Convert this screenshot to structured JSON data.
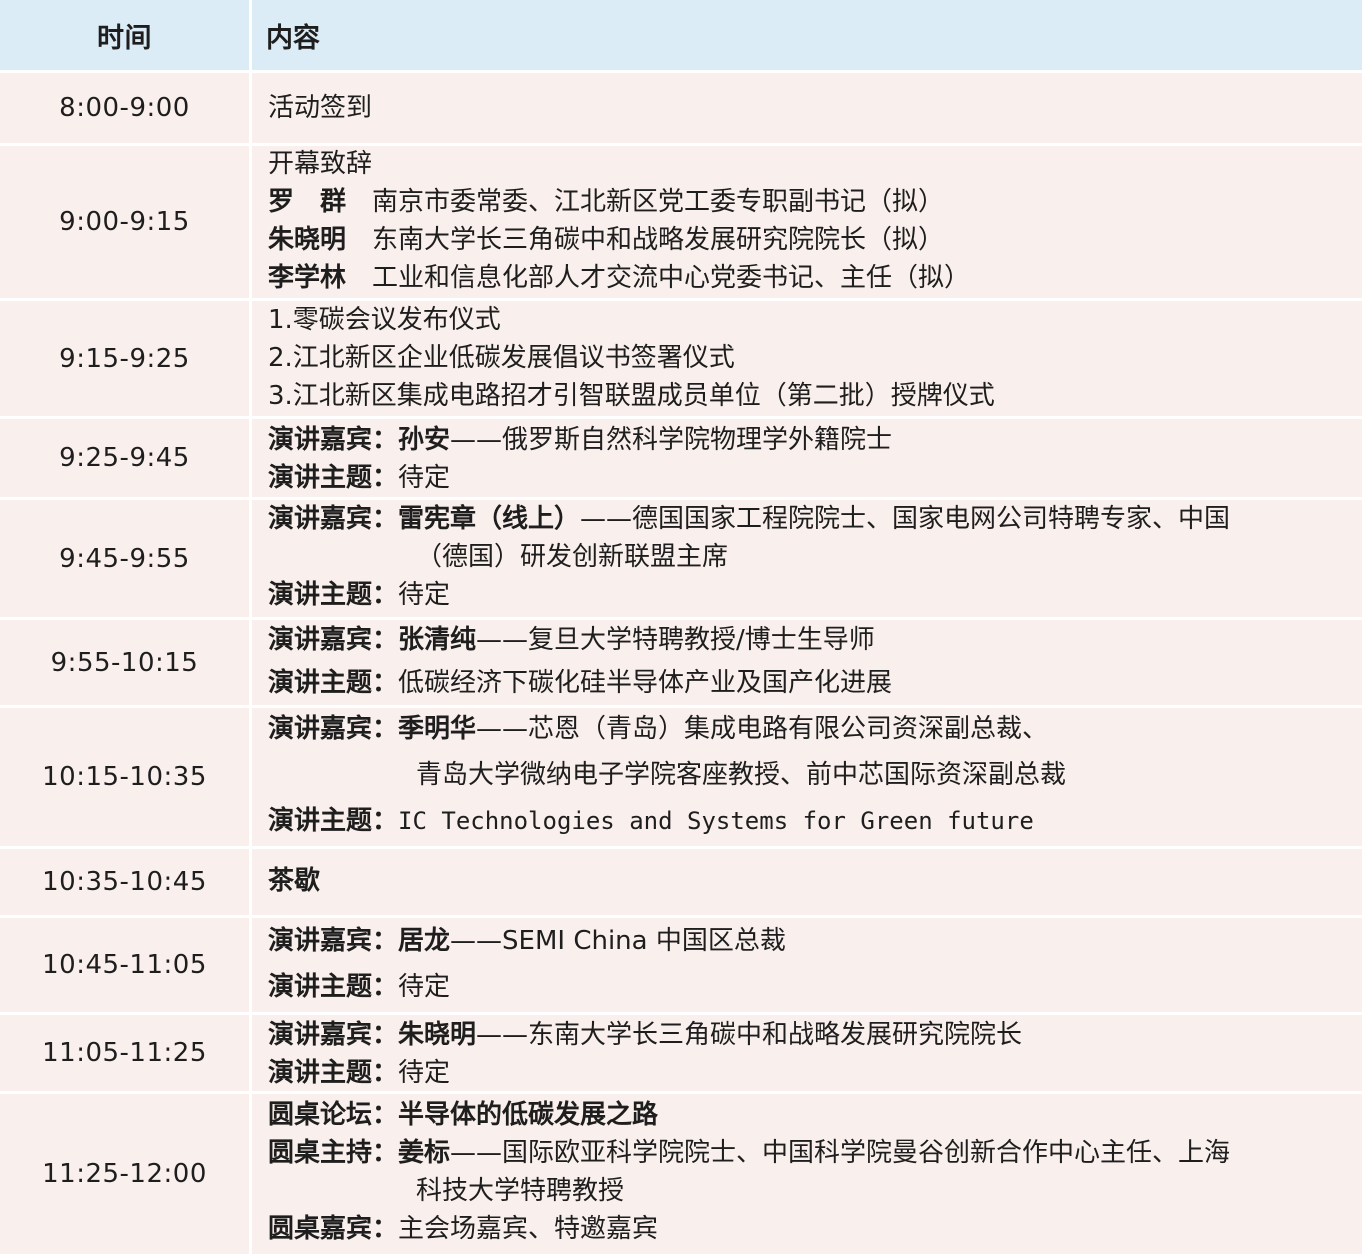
{
  "header": {
    "time": "时间",
    "content": "内容"
  },
  "rows": [
    {
      "time": "8:00-9:00",
      "lines": [
        {
          "t": "活动签到"
        }
      ]
    },
    {
      "time": "9:00-9:15",
      "lines": [
        {
          "t": "开幕致辞"
        },
        {
          "b": "罗　群",
          "t": "南京市委常委、江北新区党工委专职副书记（拟）"
        },
        {
          "b": "朱晓明",
          "t": "东南大学长三角碳中和战略发展研究院院长（拟）"
        },
        {
          "b": "李学林",
          "t": "工业和信息化部人才交流中心党委书记、主任（拟）"
        }
      ]
    },
    {
      "time": "9:15-9:25",
      "lines": [
        {
          "t": "1.零碳会议发布仪式"
        },
        {
          "t": "2.江北新区企业低碳发展倡议书签署仪式"
        },
        {
          "t": "3.江北新区集成电路招才引智联盟成员单位（第二批）授牌仪式"
        }
      ]
    },
    {
      "time": "9:25-9:45",
      "lines": [
        {
          "b": "演讲嘉宾：孙安",
          "t": "——俄罗斯自然科学院物理学外籍院士"
        },
        {
          "b": "演讲主题：",
          "t": "待定"
        }
      ]
    },
    {
      "time": "9:45-9:55",
      "lines": [
        {
          "b": "演讲嘉宾：雷宪章（线上）",
          "t": "——德国国家工程院院士、国家电网公司特聘专家、中国"
        },
        {
          "t": "（德国）研发创新联盟主席"
        },
        {
          "b": "演讲主题：",
          "t": "待定"
        }
      ]
    },
    {
      "time": "9:55-10:15",
      "lines": [
        {
          "b": "演讲嘉宾：张清纯",
          "t": "——复旦大学特聘教授/博士生导师"
        },
        {
          "b": "演讲主题：",
          "t": "低碳经济下碳化硅半导体产业及国产化进展"
        }
      ]
    },
    {
      "time": "10:15-10:35",
      "lines": [
        {
          "b": "演讲嘉宾：季明华",
          "t": "——芯恩（青岛）集成电路有限公司资深副总裁、"
        },
        {
          "t": "青岛大学微纳电子学院客座教授、前中芯国际资深副总裁"
        },
        {
          "b": "演讲主题：",
          "t": "IC Technologies and Systems for Green future"
        }
      ]
    },
    {
      "time": "10:35-10:45",
      "lines": [
        {
          "b": "茶歇"
        }
      ]
    },
    {
      "time": "10:45-11:05",
      "lines": [
        {
          "b": "演讲嘉宾：居龙",
          "t": "——SEMI China 中国区总裁"
        },
        {
          "b": "演讲主题：",
          "t": "待定"
        }
      ]
    },
    {
      "time": "11:05-11:25",
      "lines": [
        {
          "b": "演讲嘉宾：朱晓明",
          "t": "——东南大学长三角碳中和战略发展研究院院长"
        },
        {
          "b": "演讲主题：",
          "t": "待定"
        }
      ]
    },
    {
      "time": "11:25-12:00",
      "lines": [
        {
          "b": "圆桌论坛：半导体的低碳发展之路"
        },
        {
          "b": "圆桌主持：姜标",
          "t": "——国际欧亚科学院院士、中国科学院曼谷创新合作中心主任、上海"
        },
        {
          "t": "科技大学特聘教授"
        },
        {
          "b": "圆桌嘉宾：",
          "t": "主会场嘉宾、特邀嘉宾"
        }
      ]
    }
  ]
}
